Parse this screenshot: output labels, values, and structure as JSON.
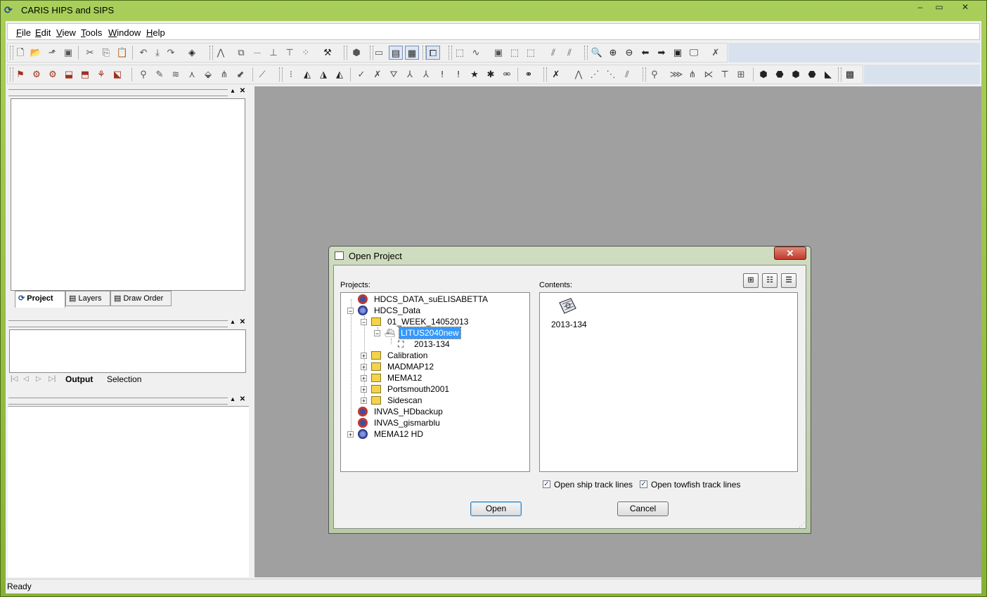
{
  "window": {
    "title": "CARIS HIPS and SIPS",
    "minimize": "‒",
    "maximize": "▭",
    "close": "✕"
  },
  "menu": [
    "File",
    "Edit",
    "View",
    "Tools",
    "Window",
    "Help"
  ],
  "left_panel": {
    "tabs": [
      "Project",
      "Layers",
      "Draw Order"
    ],
    "output_tabs": [
      "Output",
      "Selection"
    ]
  },
  "status": {
    "text": "Ready"
  },
  "dialog": {
    "title": "Open Project",
    "close": "✕",
    "projects_label": "Projects:",
    "contents_label": "Contents:",
    "tree": [
      {
        "label": "HDCS_DATA_suELISABETTA",
        "level": 0,
        "kind": "project-red",
        "expander": ""
      },
      {
        "label": "HDCS_Data",
        "level": 0,
        "kind": "project-blue",
        "expander": "−"
      },
      {
        "label": "01_WEEK_14052013",
        "level": 1,
        "kind": "folder",
        "expander": "−"
      },
      {
        "label": "LITUS2040new",
        "level": 2,
        "kind": "vessel",
        "expander": "−",
        "selected": true
      },
      {
        "label": "2013-134",
        "level": 3,
        "kind": "day",
        "expander": ""
      },
      {
        "label": "Calibration",
        "level": 1,
        "kind": "folder",
        "expander": "+"
      },
      {
        "label": "MADMAP12",
        "level": 1,
        "kind": "folder",
        "expander": "+"
      },
      {
        "label": "MEMA12",
        "level": 1,
        "kind": "folder",
        "expander": "+"
      },
      {
        "label": "Portsmouth2001",
        "level": 1,
        "kind": "folder",
        "expander": "+"
      },
      {
        "label": "Sidescan",
        "level": 1,
        "kind": "folder",
        "expander": "+"
      },
      {
        "label": "INVAS_HDbackup",
        "level": 0,
        "kind": "project-red",
        "expander": ""
      },
      {
        "label": "INVAS_gismarblu",
        "level": 0,
        "kind": "project-red",
        "expander": ""
      },
      {
        "label": "MEMA12 HD",
        "level": 0,
        "kind": "project-blue",
        "expander": "+"
      }
    ],
    "contents": [
      {
        "label": "2013-134",
        "icon": "day-icon"
      }
    ],
    "check_ship": {
      "label": "Open ship track lines",
      "checked": true
    },
    "check_towfish": {
      "label": "Open towfish track lines",
      "checked": true
    },
    "open_button": "Open",
    "cancel_button": "Cancel",
    "view_buttons": [
      "large-icons",
      "list",
      "details"
    ]
  },
  "colors": {
    "frame_green": "#8fb93a",
    "mdi_gray": "#a0a0a0",
    "selection": "#3399ff"
  }
}
